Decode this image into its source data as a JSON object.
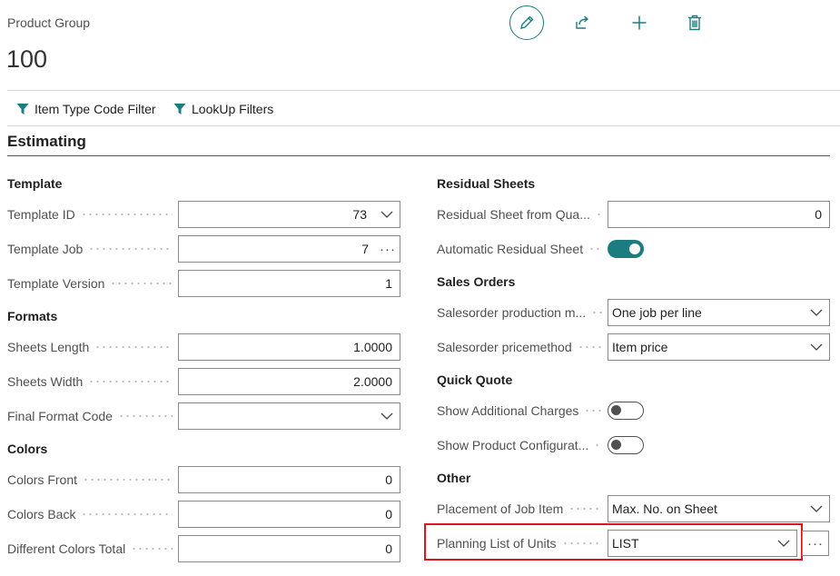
{
  "header": {
    "caption": "Product Group",
    "title": "100",
    "accent_color": "#1b7d80"
  },
  "actions": {
    "edit_icon": "pencil-icon",
    "share_icon": "share-icon",
    "new_icon": "plus-icon",
    "delete_icon": "trash-icon"
  },
  "filters": {
    "item_type_code_filter": "Item Type Code Filter",
    "lookup_filters": "LookUp Filters",
    "icon": "funnel-icon"
  },
  "section": {
    "title": "Estimating"
  },
  "left": {
    "template": {
      "title": "Template",
      "template_id": {
        "label": "Template ID",
        "value": "73"
      },
      "template_job": {
        "label": "Template Job",
        "value": "7"
      },
      "template_version": {
        "label": "Template Version",
        "value": "1"
      }
    },
    "formats": {
      "title": "Formats",
      "sheets_length": {
        "label": "Sheets Length",
        "value": "1.0000"
      },
      "sheets_width": {
        "label": "Sheets Width",
        "value": "2.0000"
      },
      "final_format_code": {
        "label": "Final Format Code",
        "value": ""
      }
    },
    "colors": {
      "title": "Colors",
      "colors_front": {
        "label": "Colors Front",
        "value": "0"
      },
      "colors_back": {
        "label": "Colors Back",
        "value": "0"
      },
      "different_colors_total": {
        "label": "Different Colors Total",
        "value": "0"
      }
    }
  },
  "right": {
    "residual_sheets": {
      "title": "Residual Sheets",
      "residual_sheet_from_qua": {
        "label": "Residual Sheet from Qua...",
        "value": "0"
      },
      "automatic_residual_sheet": {
        "label": "Automatic Residual Sheet",
        "on": true
      }
    },
    "sales_orders": {
      "title": "Sales Orders",
      "salesorder_production": {
        "label": "Salesorder production m...",
        "value": "One job per line"
      },
      "salesorder_pricemethod": {
        "label": "Salesorder pricemethod",
        "value": "Item price"
      }
    },
    "quick_quote": {
      "title": "Quick Quote",
      "show_additional_charges": {
        "label": "Show Additional Charges",
        "on": false
      },
      "show_product_configurat": {
        "label": "Show Product Configurat...",
        "on": false
      }
    },
    "other": {
      "title": "Other",
      "placement_of_job_item": {
        "label": "Placement of Job Item",
        "value": "Max. No. on Sheet"
      },
      "planning_list_of_units": {
        "label": "Planning List of Units",
        "value": "LIST"
      }
    }
  },
  "highlight_color": "#e0141e"
}
